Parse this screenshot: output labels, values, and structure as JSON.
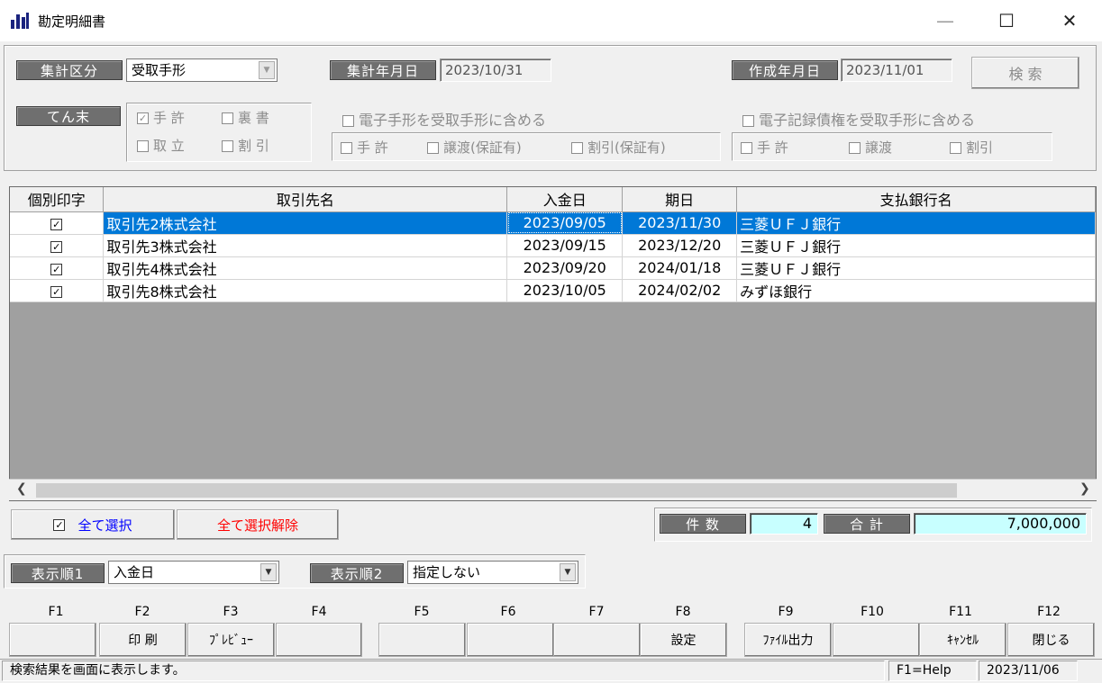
{
  "window": {
    "title": "勘定明細書",
    "minimize": "—",
    "maximize": "☐",
    "close": "✕"
  },
  "filters": {
    "category_label": "集計区分",
    "category_value": "受取手形",
    "agg_date_label": "集計年月日",
    "agg_date_value": "2023/10/31",
    "created_date_label": "作成年月日",
    "created_date_value": "2023/11/01",
    "search_button": "検 索",
    "tenmatsu_label": "てん末",
    "opt_tekyo": "手 許",
    "opt_ura": "裏 書",
    "opt_toritate": "取 立",
    "opt_waribiki": "割 引",
    "include_e_note": "電子手形を受取手形に含める",
    "e_tekyo": "手 許",
    "e_jouto": "譲渡(保証有)",
    "e_waribiki": "割引(保証有)",
    "include_e_claim": "電子記録債権を受取手形に含める",
    "c_tekyo": "手 許",
    "c_jouto": "譲渡",
    "c_waribiki": "割引"
  },
  "grid": {
    "headers": [
      "個別印字",
      "取引先名",
      "入金日",
      "期日",
      "支払銀行名"
    ],
    "rows": [
      {
        "check": "✓",
        "name": "取引先2株式会社",
        "nyukin": "2023/09/05",
        "kijitsu": "2023/11/30",
        "bank": "三菱ＵＦＪ銀行"
      },
      {
        "check": "✓",
        "name": "取引先3株式会社",
        "nyukin": "2023/09/15",
        "kijitsu": "2023/12/20",
        "bank": "三菱ＵＦＪ銀行"
      },
      {
        "check": "✓",
        "name": "取引先4株式会社",
        "nyukin": "2023/09/20",
        "kijitsu": "2024/01/18",
        "bank": "三菱ＵＦＪ銀行"
      },
      {
        "check": "✓",
        "name": "取引先8株式会社",
        "nyukin": "2023/10/05",
        "kijitsu": "2024/02/02",
        "bank": "みずほ銀行"
      }
    ]
  },
  "selection": {
    "select_all": "全て選択",
    "deselect_all": "全て選択解除",
    "select_all_check": "✓"
  },
  "totals": {
    "count_label": "件 数",
    "count_value": "4",
    "sum_label": "合 計",
    "sum_value": "7,000,000"
  },
  "sort": {
    "order1_label": "表示順1",
    "order1_value": "入金日",
    "order2_label": "表示順2",
    "order2_value": "指定しない"
  },
  "fkeys": {
    "labels": [
      "F1",
      "F2",
      "F3",
      "F4",
      "F5",
      "F6",
      "F7",
      "F8",
      "F9",
      "F10",
      "F11",
      "F12"
    ],
    "buttons": [
      "",
      "印 刷",
      "ﾌﾟﾚﾋﾞｭｰ",
      "",
      "",
      "",
      "",
      "設定",
      "ﾌｧｲﾙ出力",
      "",
      "ｷｬﾝｾﾙ",
      "閉じる"
    ]
  },
  "status": {
    "message": "検索結果を画面に表示します。",
    "help": "F1=Help",
    "date": "2023/11/06"
  },
  "colors": {
    "selection": "#0078d7",
    "cyan_field": "#c8ffff",
    "deselect_text": "#ff0000",
    "select_text": "#0000ff"
  }
}
